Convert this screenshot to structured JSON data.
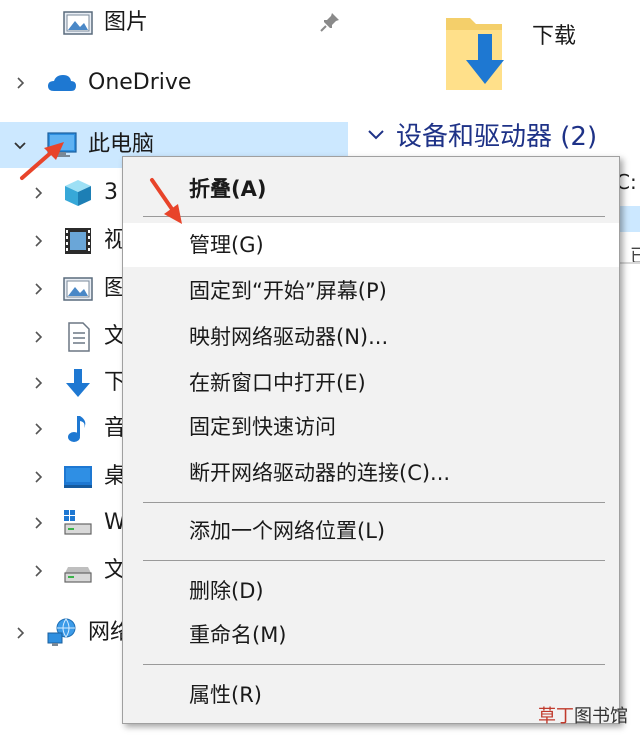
{
  "nav": {
    "items": [
      {
        "label": "图片",
        "icon": "pictures-icon",
        "expanded": null
      },
      {
        "label": "OneDrive",
        "icon": "onedrive-cloud-icon",
        "expanded": false
      },
      {
        "label": "此电脑",
        "icon": "this-pc-icon",
        "expanded": true,
        "selected": true
      },
      {
        "label": "3",
        "icon": "3d-objects-icon",
        "expanded": false
      },
      {
        "label": "视",
        "icon": "videos-icon",
        "expanded": false
      },
      {
        "label": "图",
        "icon": "pictures-icon",
        "expanded": false
      },
      {
        "label": "文",
        "icon": "documents-icon",
        "expanded": false
      },
      {
        "label": "下",
        "icon": "downloads-icon",
        "expanded": false
      },
      {
        "label": "音",
        "icon": "music-icon",
        "expanded": false
      },
      {
        "label": "桌",
        "icon": "desktop-icon",
        "expanded": false
      },
      {
        "label": "W",
        "icon": "windows-drive-icon",
        "expanded": false
      },
      {
        "label": "文",
        "icon": "drive-icon",
        "expanded": false
      },
      {
        "label": "网络",
        "icon": "network-icon",
        "expanded": false
      }
    ]
  },
  "content": {
    "downloads_label": "下载",
    "section_title": "设备和驱动器 (2)",
    "drive_letter_fragment": "C:",
    "drive_text_fragment": "已"
  },
  "context_menu": {
    "items": [
      {
        "label": "折叠(A)",
        "bold": true
      },
      {
        "label": "管理(G)",
        "hover": true
      },
      {
        "label": "固定到“开始”屏幕(P)"
      },
      {
        "label": "映射网络驱动器(N)..."
      },
      {
        "label": "在新窗口中打开(E)"
      },
      {
        "label": "固定到快速访问"
      },
      {
        "label": "断开网络驱动器的连接(C)..."
      },
      {
        "label": "添加一个网络位置(L)"
      },
      {
        "label": "删除(D)"
      },
      {
        "label": "重命名(M)"
      },
      {
        "label": "属性(R)"
      }
    ]
  },
  "watermark": {
    "part1": "草丁",
    "part2": "图书馆"
  },
  "colors": {
    "selection": "#cce8ff",
    "menu_bg": "#f2f2f2",
    "section_title": "#1e3287",
    "arrow": "#e8442a"
  }
}
